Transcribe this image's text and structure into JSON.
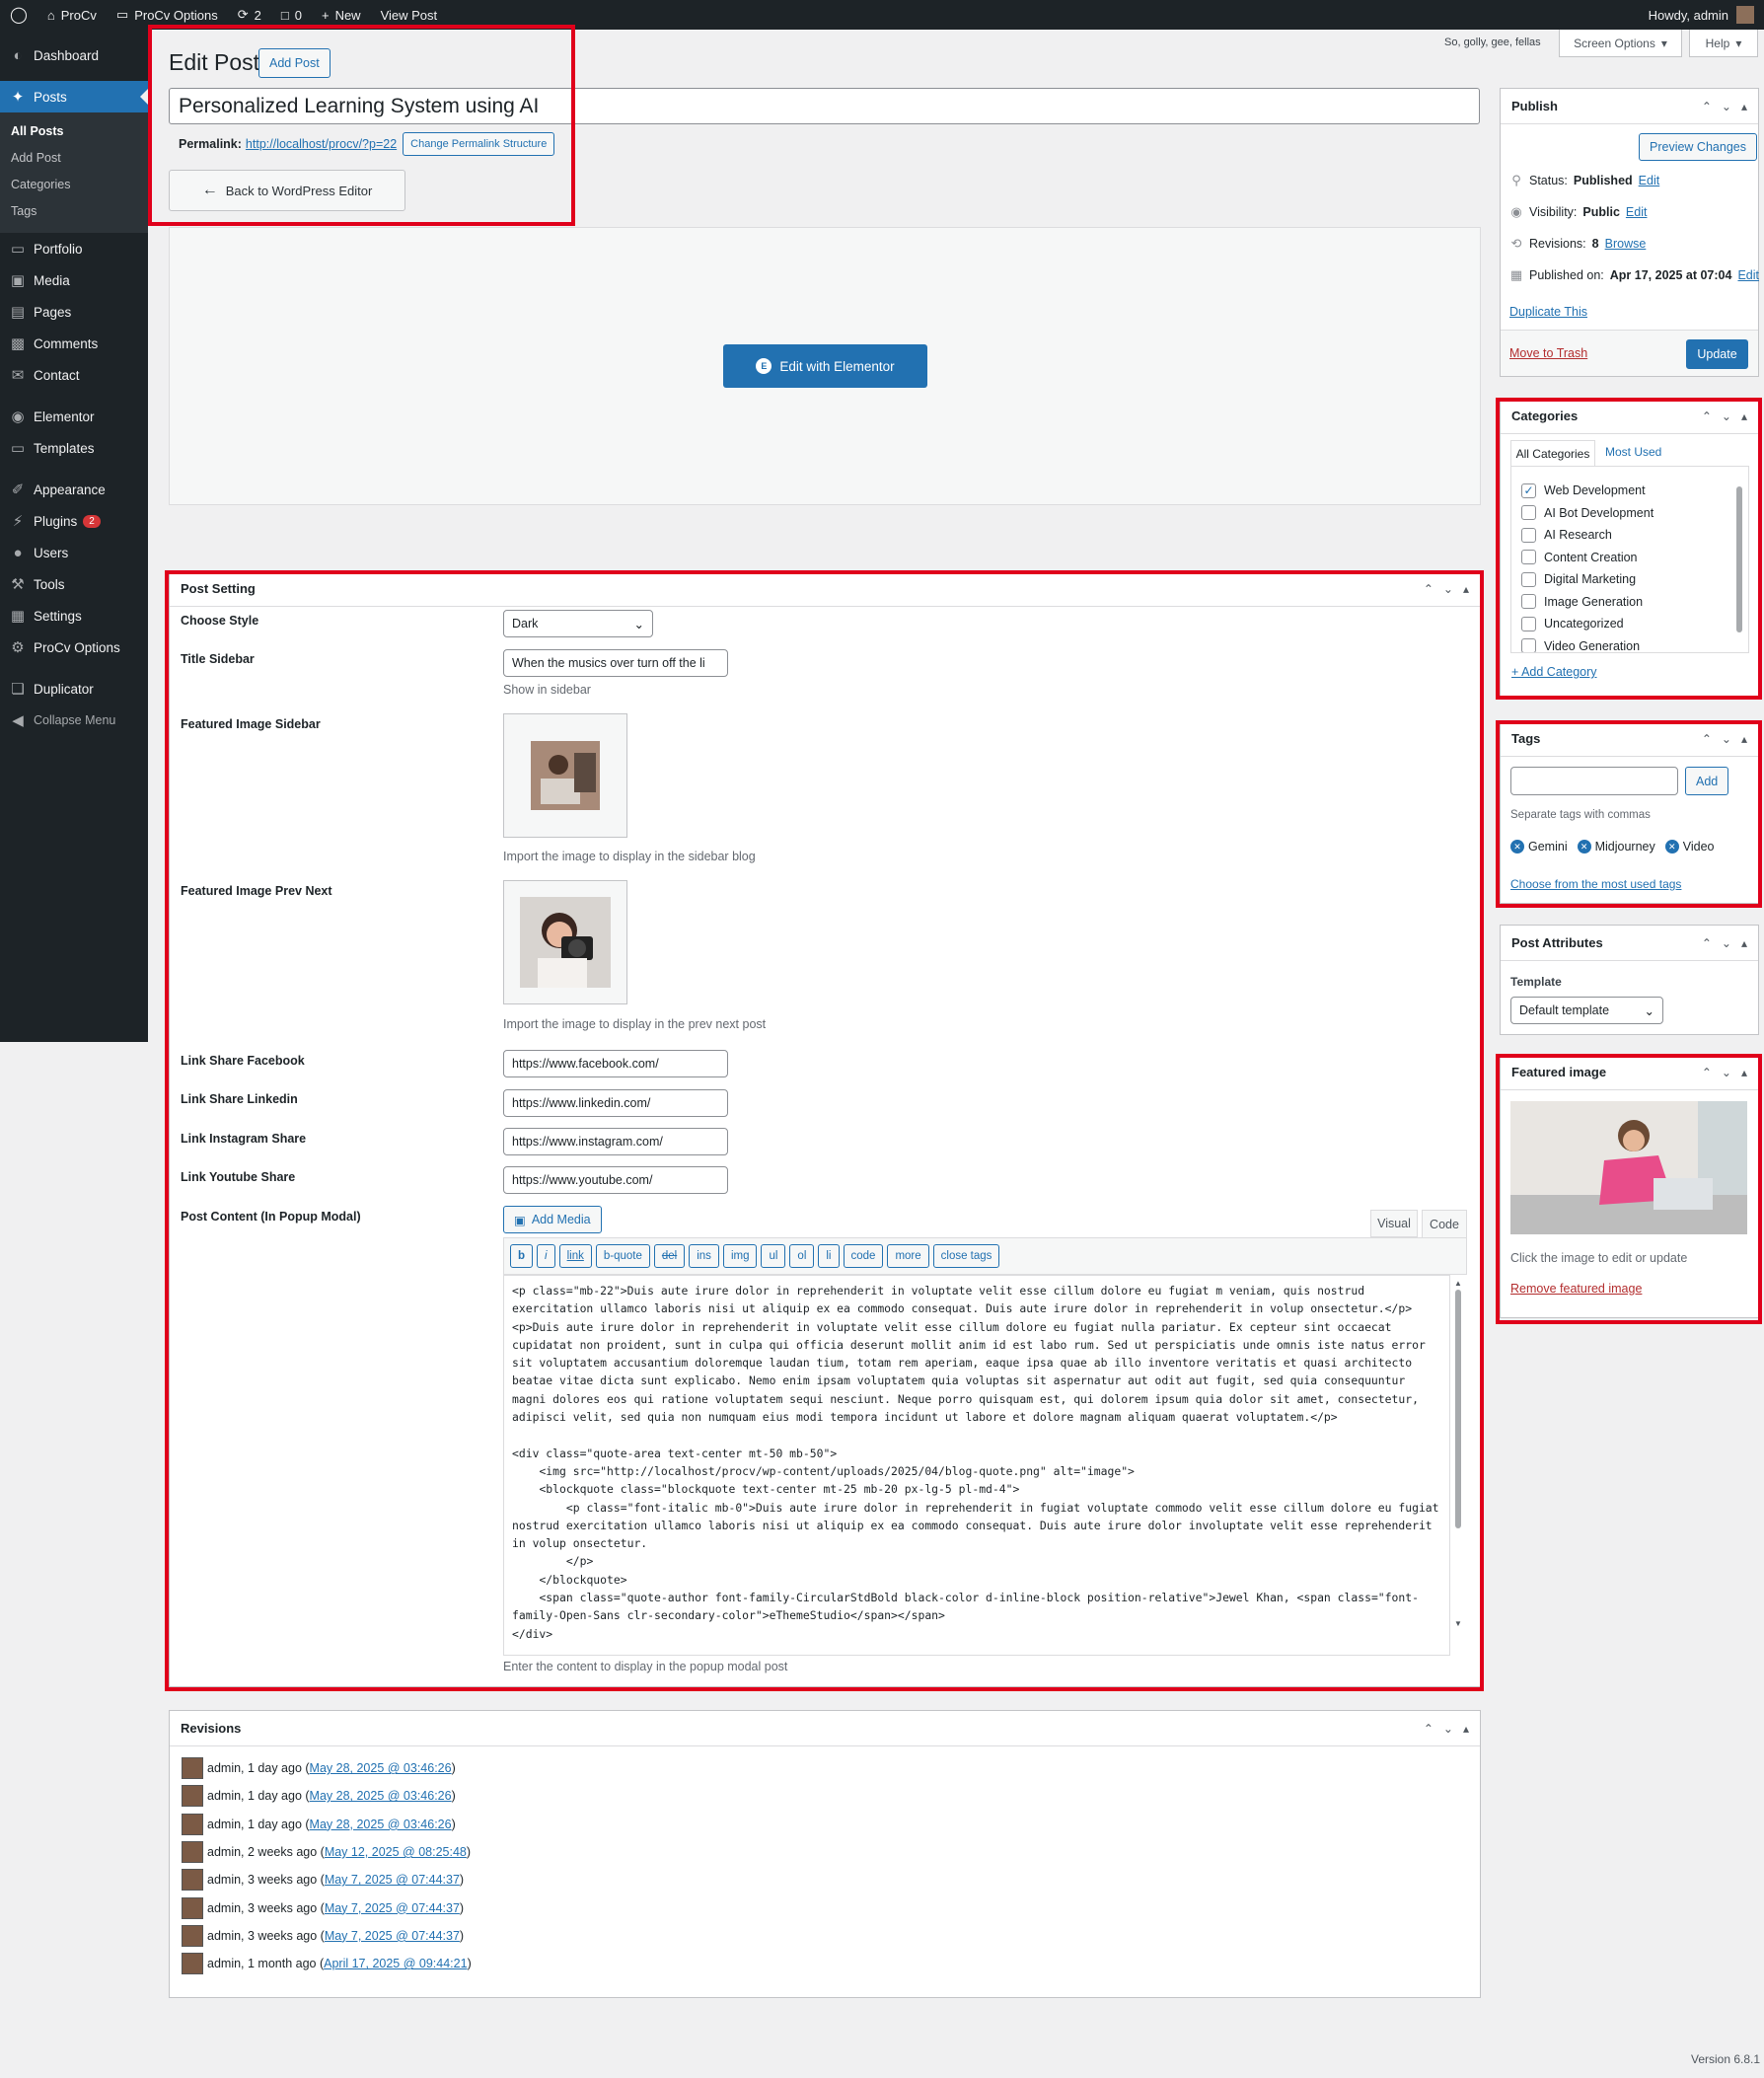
{
  "adminbar": {
    "site": "ProCv",
    "options": "ProCv Options",
    "updates": "2",
    "comments": "0",
    "new": "New",
    "view_post": "View Post",
    "howdy": "Howdy, admin"
  },
  "sidebar": {
    "items": [
      {
        "label": "Dashboard",
        "icon": "dashboard-icon"
      },
      {
        "label": "Posts",
        "icon": "pin-icon"
      },
      {
        "label": "Portfolio",
        "icon": "folder-icon"
      },
      {
        "label": "Media",
        "icon": "media-icon"
      },
      {
        "label": "Pages",
        "icon": "pages-icon"
      },
      {
        "label": "Comments",
        "icon": "comment-icon"
      },
      {
        "label": "Contact",
        "icon": "mail-icon"
      },
      {
        "label": "Elementor",
        "icon": "elementor-icon"
      },
      {
        "label": "Templates",
        "icon": "folder-icon"
      },
      {
        "label": "Appearance",
        "icon": "brush-icon"
      },
      {
        "label": "Plugins",
        "icon": "plug-icon",
        "badge": "2"
      },
      {
        "label": "Users",
        "icon": "user-icon"
      },
      {
        "label": "Tools",
        "icon": "wrench-icon"
      },
      {
        "label": "Settings",
        "icon": "settings-icon"
      },
      {
        "label": "ProCv Options",
        "icon": "gear-icon"
      },
      {
        "label": "Duplicator",
        "icon": "duplicator-icon"
      },
      {
        "label": "Collapse Menu",
        "icon": "collapse-icon"
      }
    ],
    "posts_sub": [
      "All Posts",
      "Add Post",
      "Categories",
      "Tags"
    ]
  },
  "header": {
    "title": "Edit Post",
    "add_post": "Add Post",
    "tagline": "So, golly, gee, fellas",
    "screen_options": "Screen Options",
    "help": "Help"
  },
  "post": {
    "title": "Personalized Learning System using AI",
    "permalink_label": "Permalink:",
    "permalink": "http://localhost/procv/?p=22",
    "change_permalink": "Change Permalink Structure",
    "back_editor": "Back to WordPress Editor",
    "elementor_btn": "Edit with Elementor"
  },
  "post_setting": {
    "title": "Post Setting",
    "choose_style_label": "Choose Style",
    "choose_style_value": "Dark",
    "title_sidebar_label": "Title Sidebar",
    "title_sidebar_value": "When the musics over turn off the li",
    "title_sidebar_desc": "Show in sidebar",
    "featured_sidebar_label": "Featured Image Sidebar",
    "featured_sidebar_desc": "Import the image to display in the sidebar blog",
    "featured_prev_label": "Featured Image Prev Next",
    "featured_prev_desc": "Import the image to display in the prev next post",
    "fb_label": "Link Share Facebook",
    "fb_value": "https://www.facebook.com/",
    "li_label": "Link Share Linkedin",
    "li_value": "https://www.linkedin.com/",
    "ig_label": "Link Instagram Share",
    "ig_value": "https://www.instagram.com/",
    "yt_label": "Link Youtube Share",
    "yt_value": "https://www.youtube.com/",
    "content_label": "Post Content (In Popup Modal)",
    "add_media": "Add Media",
    "tab_visual": "Visual",
    "tab_code": "Code",
    "quicktags": [
      "b",
      "i",
      "link",
      "b-quote",
      "del",
      "ins",
      "img",
      "ul",
      "ol",
      "li",
      "code",
      "more",
      "close tags"
    ],
    "code": "<p class=\"mb-22\">Duis aute irure dolor in reprehenderit in voluptate velit esse cillum dolore eu fugiat m veniam, quis nostrud exercitation ullamco laboris nisi ut aliquip ex ea commodo consequat. Duis aute irure dolor in reprehenderit in volup onsectetur.</p>\n<p>Duis aute irure dolor in reprehenderit in voluptate velit esse cillum dolore eu fugiat nulla pariatur. Ex cepteur sint occaecat cupidatat non proident, sunt in culpa qui officia deserunt mollit anim id est labo rum. Sed ut perspiciatis unde omnis iste natus error sit voluptatem accusantium doloremque laudan tium, totam rem aperiam, eaque ipsa quae ab illo inventore veritatis et quasi architecto beatae vitae dicta sunt explicabo. Nemo enim ipsam voluptatem quia voluptas sit aspernatur aut odit aut fugit, sed quia consequuntur magni dolores eos qui ratione voluptatem sequi nesciunt. Neque porro quisquam est, qui dolorem ipsum quia dolor sit amet, consectetur, adipisci velit, sed quia non numquam eius modi tempora incidunt ut labore et dolore magnam aliquam quaerat voluptatem.</p>\n\n<div class=\"quote-area text-center mt-50 mb-50\">\n    <img src=\"http://localhost/procv/wp-content/uploads/2025/04/blog-quote.png\" alt=\"image\">\n    <blockquote class=\"blockquote text-center mt-25 mb-20 px-lg-5 pl-md-4\">\n        <p class=\"font-italic mb-0\">Duis aute irure dolor in reprehenderit in fugiat voluptate commodo velit esse cillum dolore eu fugiat nostrud exercitation ullamco laboris nisi ut aliquip ex ea commodo consequat. Duis aute irure dolor involuptate velit esse reprehenderit in volup onsectetur.\n        </p>\n    </blockquote>\n    <span class=\"quote-author font-family-CircularStdBold black-color d-inline-block position-relative\">Jewel Khan, <span class=\"font-family-Open-Sans clr-secondary-color\">eThemeStudio</span></span>\n</div>",
    "content_desc": "Enter the content to display in the popup modal post"
  },
  "revisions": {
    "title": "Revisions",
    "items": [
      {
        "who": "admin, 1 day ago (",
        "link": "May 28, 2025 @ 03:46:26",
        "end": ")"
      },
      {
        "who": "admin, 1 day ago (",
        "link": "May 28, 2025 @ 03:46:26",
        "end": ")"
      },
      {
        "who": "admin, 1 day ago (",
        "link": "May 28, 2025 @ 03:46:26",
        "end": ")"
      },
      {
        "who": "admin, 2 weeks ago (",
        "link": "May 12, 2025 @ 08:25:48",
        "end": ")"
      },
      {
        "who": "admin, 3 weeks ago (",
        "link": "May 7, 2025 @ 07:44:37",
        "end": ")"
      },
      {
        "who": "admin, 3 weeks ago (",
        "link": "May 7, 2025 @ 07:44:37",
        "end": ")"
      },
      {
        "who": "admin, 3 weeks ago (",
        "link": "May 7, 2025 @ 07:44:37",
        "end": ")"
      },
      {
        "who": "admin, 1 month ago (",
        "link": "April 17, 2025 @ 09:44:21",
        "end": ")"
      }
    ]
  },
  "publish": {
    "title": "Publish",
    "preview": "Preview Changes",
    "status_label": "Status:",
    "status": "Published",
    "visibility_label": "Visibility:",
    "visibility": "Public",
    "revisions_label": "Revisions:",
    "revisions": "8",
    "browse": "Browse",
    "published_label": "Published on:",
    "published": "Apr 17, 2025 at 07:04",
    "edit": "Edit",
    "duplicate": "Duplicate This",
    "trash": "Move to Trash",
    "update": "Update"
  },
  "categories": {
    "title": "Categories",
    "tab_all": "All Categories",
    "tab_most": "Most Used",
    "items": [
      {
        "label": "Web Development",
        "checked": true
      },
      {
        "label": "AI Bot Development",
        "checked": false
      },
      {
        "label": "AI Research",
        "checked": false
      },
      {
        "label": "Content Creation",
        "checked": false
      },
      {
        "label": "Digital Marketing",
        "checked": false
      },
      {
        "label": "Image Generation",
        "checked": false
      },
      {
        "label": "Uncategorized",
        "checked": false
      },
      {
        "label": "Video Generation",
        "checked": false
      }
    ],
    "add": "+ Add Category"
  },
  "tags": {
    "title": "Tags",
    "add": "Add",
    "hint": "Separate tags with commas",
    "items": [
      "Gemini",
      "Midjourney",
      "Video"
    ],
    "choose": "Choose from the most used tags"
  },
  "attributes": {
    "title": "Post Attributes",
    "template_label": "Template",
    "template_value": "Default template"
  },
  "featured": {
    "title": "Featured image",
    "hint": "Click the image to edit or update",
    "remove": "Remove featured image"
  },
  "footer": {
    "version": "Version 6.8.1"
  },
  "colors": {
    "accent": "#2271b1",
    "highlight": "#e0001b",
    "sidebar": "#1d2327"
  }
}
